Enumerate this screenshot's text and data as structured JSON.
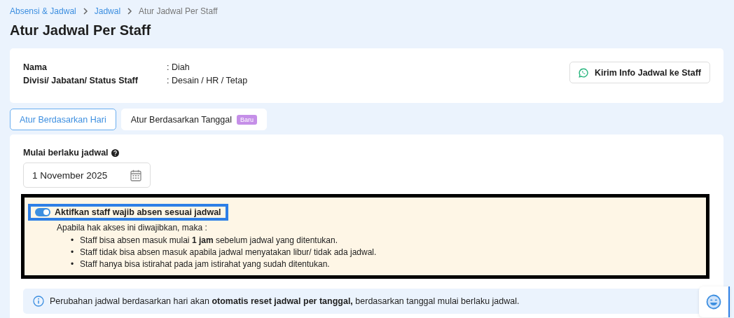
{
  "breadcrumb": [
    {
      "label": "Absensi & Jadwal",
      "kind": "link"
    },
    {
      "label": "Jadwal",
      "kind": "link"
    },
    {
      "label": "Atur Jadwal Per Staff",
      "kind": "current"
    }
  ],
  "title": "Atur Jadwal Per Staff",
  "staff_info": [
    {
      "label": "Nama",
      "value": ": Diah"
    },
    {
      "label": "Divisi/ Jabatan/ Status Staff",
      "value": ": Desain / HR / Tetap"
    }
  ],
  "send_button": "Kirim Info Jadwal ke Staff",
  "tabs": [
    {
      "label": "Atur Berdasarkan Hari",
      "selected": true
    },
    {
      "label": "Atur Berdasarkan Tanggal",
      "selected": false,
      "badge": "Baru"
    }
  ],
  "start_date": {
    "label": "Mulai berlaku jadwal",
    "value": "1 November 2025"
  },
  "mandatory": {
    "label": "Aktifkan staff wajib absen sesuai jadwal",
    "on": true,
    "intro": "Apabila hak akses ini diwajibkan, maka :",
    "rules": [
      {
        "marker": "•",
        "text": "Staff bisa absen masuk mulai **1 jam** sebelum jadwal yang ditentukan."
      },
      {
        "marker": "•",
        "text": "Staff tidak bisa absen masuk apabila jadwal menyatakan libur/ tidak ada jadwal."
      },
      {
        "marker": "•",
        "text": "Staff hanya bisa istirahat pada jam istirahat yang sudah ditentukan."
      }
    ]
  },
  "notice": "Perubahan jadwal berdasarkan hari akan **otomatis reset jadwal per tanggal,** berdasarkan tanggal mulai berlaku jadwal."
}
